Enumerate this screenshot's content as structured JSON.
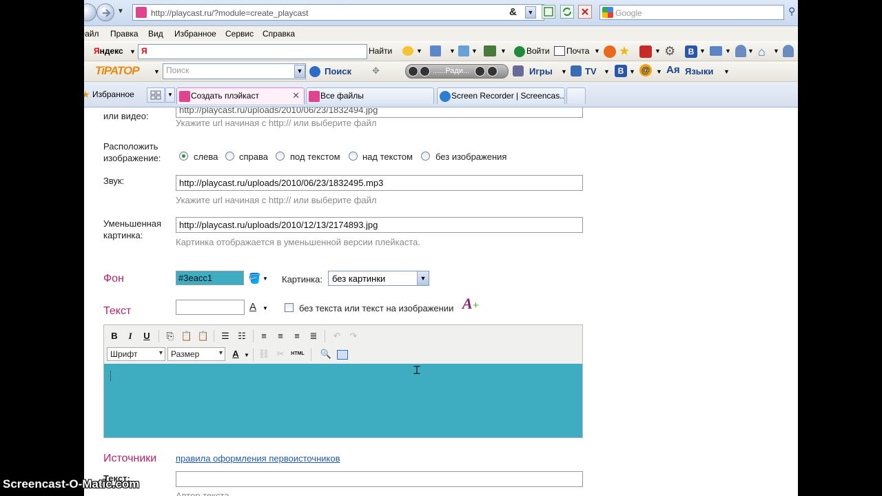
{
  "browser": {
    "url": "http://playcast.ru/?module=create_playcast",
    "url_amp": "&",
    "search_placeholder": "Google"
  },
  "menu": [
    "Файл",
    "Правка",
    "Вид",
    "Избранное",
    "Сервис",
    "Справка"
  ],
  "yandex_bar": {
    "brand": "Яндекс",
    "input_value": "Я",
    "find": "Найти",
    "login": "Войти",
    "mail": "Почта"
  },
  "tirator_bar": {
    "brand": "TiPATOP",
    "search_placeholder": "Поиск",
    "search_button": "Поиск",
    "radio": "......Ради...",
    "games": "Игры",
    "tv": "TV",
    "languages": "Языки"
  },
  "tabs_bar": {
    "favorites": "Избранное",
    "tabs": [
      {
        "label": "Создать плэйкаст",
        "active": true
      },
      {
        "label": "Все файлы",
        "active": false
      },
      {
        "label": "Screen Recorder | Screencas...",
        "active": false
      }
    ]
  },
  "form": {
    "image_url_partial": "http://playcast.ru/uploads/2010/06/23/1832494.jpg",
    "image_label_tail": "или видео:",
    "image_hint": "Укажите url начиная с http:// или выберите файл",
    "position_label": "Расположить изображение:",
    "position_options": [
      "слева",
      "справа",
      "под текстом",
      "над текстом",
      "без изображения"
    ],
    "position_selected": 0,
    "sound_label": "Звук:",
    "sound_value": "http://playcast.ru/uploads/2010/06/23/1832495.mp3",
    "sound_hint": "Укажите url начиная с http:// или выберите файл",
    "thumb_label": "Уменьшенная картинка:",
    "thumb_value": "http://playcast.ru/uploads/2010/12/13/2174893.jpg",
    "thumb_hint": "Картинка отображается в уменьшенной версии плейкаста.",
    "bg_section": "Фон",
    "bg_color_value": "#3eacc1",
    "bg_color": "#3eacc1",
    "picture_label": "Картинка:",
    "picture_value": "без картинки",
    "text_section": "Текст",
    "text_color_value": "",
    "no_text_label": "без текста или текст на изображении",
    "editor": {
      "font_placeholder": "Шрифт",
      "size_placeholder": "Размер",
      "html_label": "HTML",
      "area_color": "#3eacc1"
    },
    "sources_section": "Источники",
    "sources_link": "правила оформления первоисточников",
    "sources_text_label": "Текст:",
    "sources_author_hint": "Автор текста"
  },
  "watermark": "Screencast-O-Matic.com"
}
